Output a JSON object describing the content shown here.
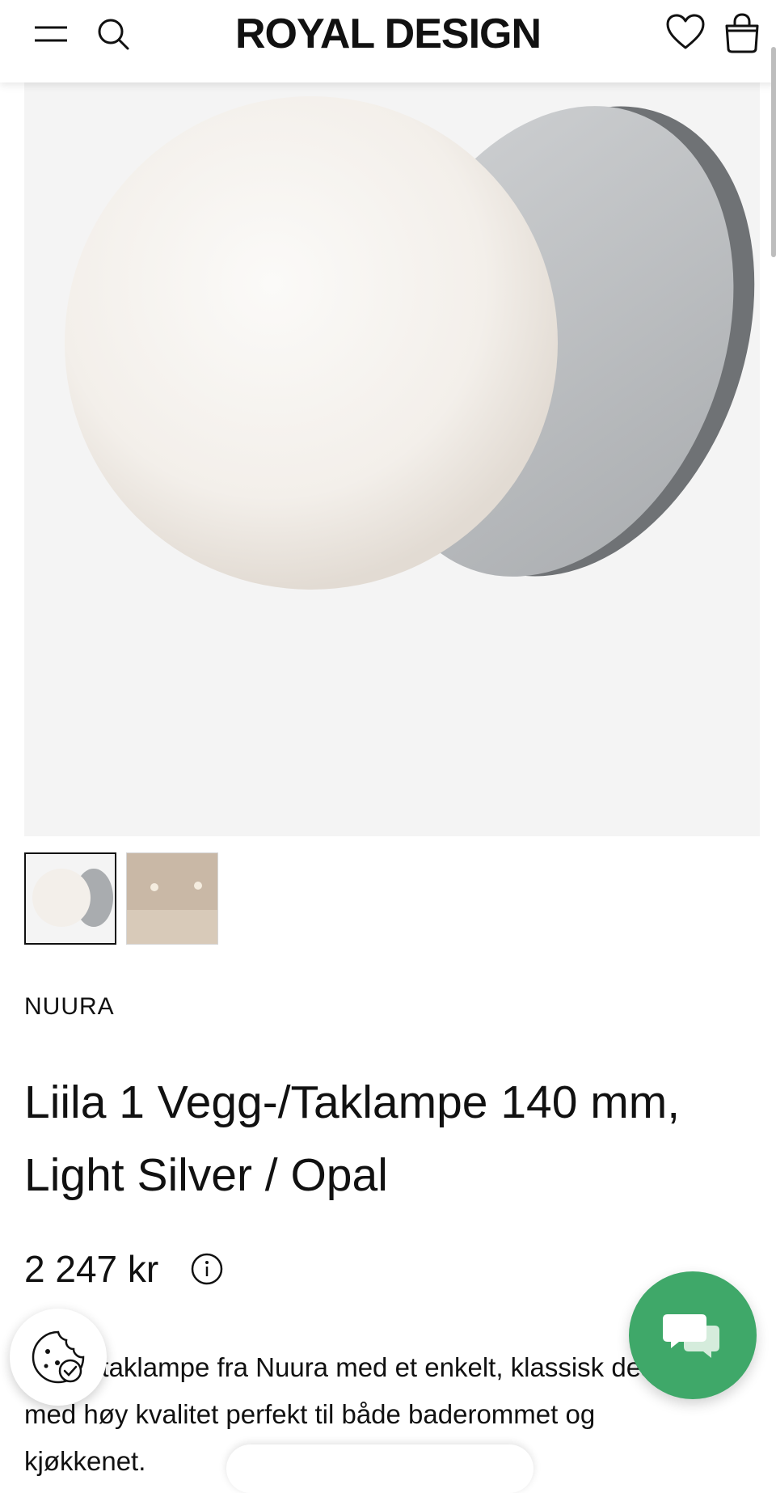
{
  "header": {
    "logo": "ROYAL DESIGN",
    "icons": [
      "menu-icon",
      "search-icon",
      "heart-icon",
      "shopping-bag-icon"
    ]
  },
  "product": {
    "brand": "NUURA",
    "title": "Liila 1 Vegg-/Taklampe 140 mm, Light Silver / Opal",
    "price": "2 247 kr",
    "description": "Vegg-/taklampe fra Nuura med et enkelt, klassisk design med høy kvalitet perfekt til både baderommet og kjøkkenet."
  },
  "gallery": {
    "thumbnail_count": 2,
    "active_index": 0
  },
  "colors": {
    "chat_green": "#3fa869",
    "image_bg": "#f4f4f4"
  }
}
